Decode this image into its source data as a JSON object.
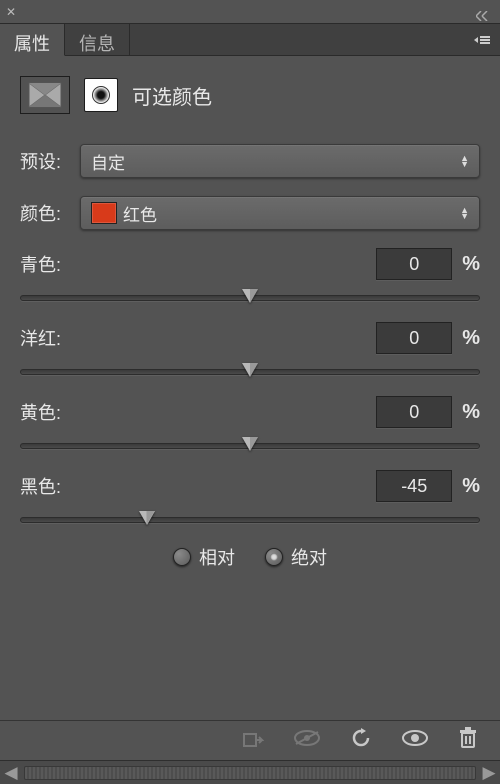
{
  "tabs": {
    "properties": "属性",
    "info": "信息"
  },
  "adjustment": {
    "title": "可选颜色"
  },
  "preset": {
    "label": "预设:",
    "value": "自定"
  },
  "color": {
    "label": "颜色:",
    "value": "红色",
    "swatch": "#d83a1a"
  },
  "sliders": {
    "cyan": {
      "label": "青色:",
      "value": "0",
      "percent": 50
    },
    "magenta": {
      "label": "洋红:",
      "value": "0",
      "percent": 50
    },
    "yellow": {
      "label": "黄色:",
      "value": "0",
      "percent": 50
    },
    "black": {
      "label": "黑色:",
      "value": "-45",
      "percent": 27.5
    }
  },
  "mode": {
    "relative": {
      "label": "相对",
      "checked": false
    },
    "absolute": {
      "label": "绝对",
      "checked": true
    }
  },
  "percent_symbol": "%"
}
